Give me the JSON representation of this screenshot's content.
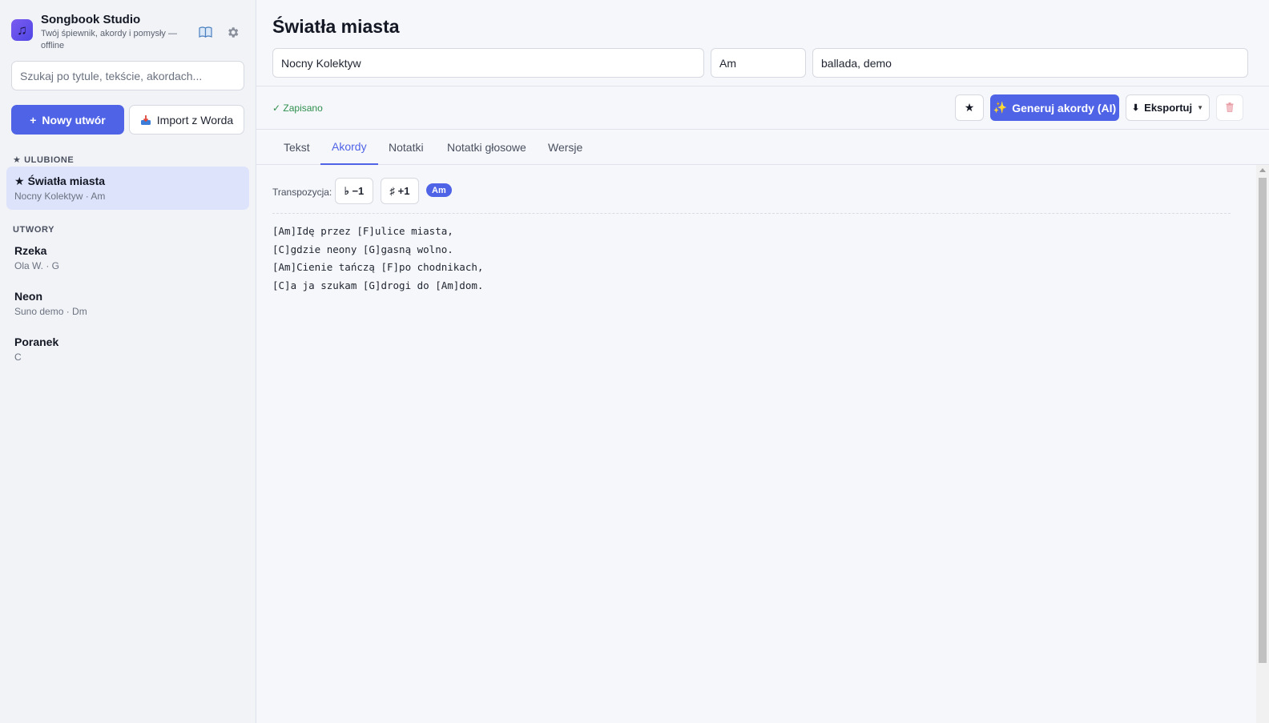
{
  "app": {
    "title": "Songbook Studio",
    "subtitle": "Twój śpiewnik, akordy i pomysły — offline"
  },
  "sidebar": {
    "search_placeholder": "Szukaj po tytule, tekście, akordach...",
    "new_button": "Nowy utwór",
    "new_icon": "+",
    "import_button": "Import z Worda",
    "favorites_label": "★ ULUBIONE",
    "songs_label": "UTWORY",
    "favorites": [
      {
        "star": "★",
        "title": "Światła miasta",
        "meta": "Nocny Kolektyw · Am"
      }
    ],
    "songs": [
      {
        "title": "Rzeka",
        "meta": "Ola W. · G"
      },
      {
        "title": "Neon",
        "meta": "Suno demo · Dm"
      },
      {
        "title": "Poranek",
        "meta": "C"
      }
    ]
  },
  "song": {
    "title": "Światła miasta",
    "artist": "Nocny Kolektyw",
    "key": "Am",
    "tags": "ballada, demo"
  },
  "toolbar": {
    "saved": "✓ Zapisano",
    "star": "★",
    "generate": "Generuj akordy (AI)",
    "generate_icon": "✨",
    "export": "Eksportuj",
    "export_icon": "⬇",
    "export_caret": "▼"
  },
  "tabs": [
    "Tekst",
    "Akordy",
    "Notatki",
    "Notatki głosowe",
    "Wersje"
  ],
  "chords": {
    "transpose_label": "Transpozycja:",
    "down": "♭ −1",
    "up": "♯ +1",
    "current_key": "Am",
    "lines": [
      "[Am]Idę przez [F]ulice miasta,",
      "[C]gdzie neony [G]gasną wolno.",
      "[Am]Cienie tańczą [F]po chodnikach,",
      "[C]a ja szukam [G]drogi do [Am]dom."
    ]
  },
  "colors": {
    "accent": "#4f63e6",
    "active_item": "#dde3fb",
    "saved": "#2f8f4e",
    "trash": "#e8a0a8"
  }
}
